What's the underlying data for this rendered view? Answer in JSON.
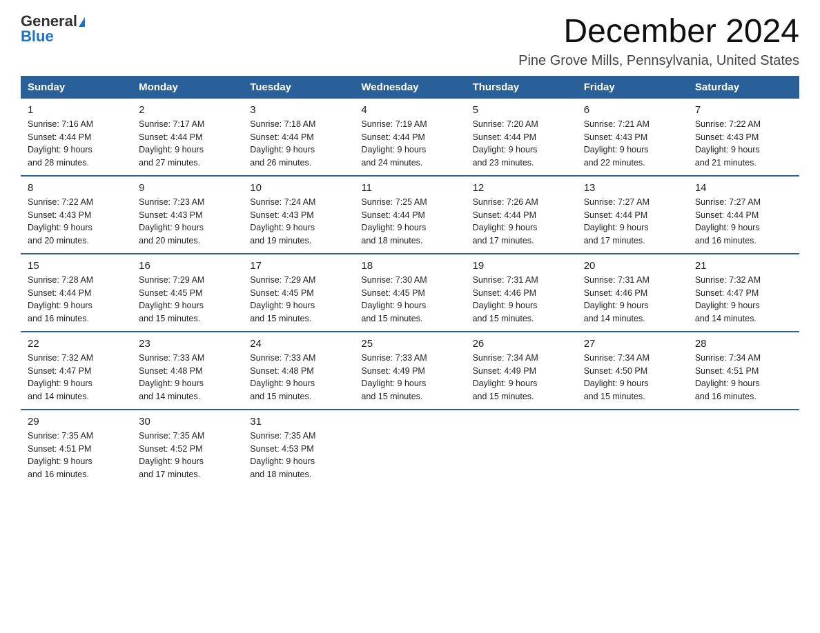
{
  "logo": {
    "general": "General",
    "blue": "Blue"
  },
  "header": {
    "title": "December 2024",
    "subtitle": "Pine Grove Mills, Pennsylvania, United States"
  },
  "days_of_week": [
    "Sunday",
    "Monday",
    "Tuesday",
    "Wednesday",
    "Thursday",
    "Friday",
    "Saturday"
  ],
  "weeks": [
    [
      {
        "day": "1",
        "sunrise": "7:16 AM",
        "sunset": "4:44 PM",
        "daylight": "9 hours and 28 minutes."
      },
      {
        "day": "2",
        "sunrise": "7:17 AM",
        "sunset": "4:44 PM",
        "daylight": "9 hours and 27 minutes."
      },
      {
        "day": "3",
        "sunrise": "7:18 AM",
        "sunset": "4:44 PM",
        "daylight": "9 hours and 26 minutes."
      },
      {
        "day": "4",
        "sunrise": "7:19 AM",
        "sunset": "4:44 PM",
        "daylight": "9 hours and 24 minutes."
      },
      {
        "day": "5",
        "sunrise": "7:20 AM",
        "sunset": "4:44 PM",
        "daylight": "9 hours and 23 minutes."
      },
      {
        "day": "6",
        "sunrise": "7:21 AM",
        "sunset": "4:43 PM",
        "daylight": "9 hours and 22 minutes."
      },
      {
        "day": "7",
        "sunrise": "7:22 AM",
        "sunset": "4:43 PM",
        "daylight": "9 hours and 21 minutes."
      }
    ],
    [
      {
        "day": "8",
        "sunrise": "7:22 AM",
        "sunset": "4:43 PM",
        "daylight": "9 hours and 20 minutes."
      },
      {
        "day": "9",
        "sunrise": "7:23 AM",
        "sunset": "4:43 PM",
        "daylight": "9 hours and 20 minutes."
      },
      {
        "day": "10",
        "sunrise": "7:24 AM",
        "sunset": "4:43 PM",
        "daylight": "9 hours and 19 minutes."
      },
      {
        "day": "11",
        "sunrise": "7:25 AM",
        "sunset": "4:44 PM",
        "daylight": "9 hours and 18 minutes."
      },
      {
        "day": "12",
        "sunrise": "7:26 AM",
        "sunset": "4:44 PM",
        "daylight": "9 hours and 17 minutes."
      },
      {
        "day": "13",
        "sunrise": "7:27 AM",
        "sunset": "4:44 PM",
        "daylight": "9 hours and 17 minutes."
      },
      {
        "day": "14",
        "sunrise": "7:27 AM",
        "sunset": "4:44 PM",
        "daylight": "9 hours and 16 minutes."
      }
    ],
    [
      {
        "day": "15",
        "sunrise": "7:28 AM",
        "sunset": "4:44 PM",
        "daylight": "9 hours and 16 minutes."
      },
      {
        "day": "16",
        "sunrise": "7:29 AM",
        "sunset": "4:45 PM",
        "daylight": "9 hours and 15 minutes."
      },
      {
        "day": "17",
        "sunrise": "7:29 AM",
        "sunset": "4:45 PM",
        "daylight": "9 hours and 15 minutes."
      },
      {
        "day": "18",
        "sunrise": "7:30 AM",
        "sunset": "4:45 PM",
        "daylight": "9 hours and 15 minutes."
      },
      {
        "day": "19",
        "sunrise": "7:31 AM",
        "sunset": "4:46 PM",
        "daylight": "9 hours and 15 minutes."
      },
      {
        "day": "20",
        "sunrise": "7:31 AM",
        "sunset": "4:46 PM",
        "daylight": "9 hours and 14 minutes."
      },
      {
        "day": "21",
        "sunrise": "7:32 AM",
        "sunset": "4:47 PM",
        "daylight": "9 hours and 14 minutes."
      }
    ],
    [
      {
        "day": "22",
        "sunrise": "7:32 AM",
        "sunset": "4:47 PM",
        "daylight": "9 hours and 14 minutes."
      },
      {
        "day": "23",
        "sunrise": "7:33 AM",
        "sunset": "4:48 PM",
        "daylight": "9 hours and 14 minutes."
      },
      {
        "day": "24",
        "sunrise": "7:33 AM",
        "sunset": "4:48 PM",
        "daylight": "9 hours and 15 minutes."
      },
      {
        "day": "25",
        "sunrise": "7:33 AM",
        "sunset": "4:49 PM",
        "daylight": "9 hours and 15 minutes."
      },
      {
        "day": "26",
        "sunrise": "7:34 AM",
        "sunset": "4:49 PM",
        "daylight": "9 hours and 15 minutes."
      },
      {
        "day": "27",
        "sunrise": "7:34 AM",
        "sunset": "4:50 PM",
        "daylight": "9 hours and 15 minutes."
      },
      {
        "day": "28",
        "sunrise": "7:34 AM",
        "sunset": "4:51 PM",
        "daylight": "9 hours and 16 minutes."
      }
    ],
    [
      {
        "day": "29",
        "sunrise": "7:35 AM",
        "sunset": "4:51 PM",
        "daylight": "9 hours and 16 minutes."
      },
      {
        "day": "30",
        "sunrise": "7:35 AM",
        "sunset": "4:52 PM",
        "daylight": "9 hours and 17 minutes."
      },
      {
        "day": "31",
        "sunrise": "7:35 AM",
        "sunset": "4:53 PM",
        "daylight": "9 hours and 18 minutes."
      },
      null,
      null,
      null,
      null
    ]
  ],
  "labels": {
    "sunrise": "Sunrise: ",
    "sunset": "Sunset: ",
    "daylight": "Daylight: "
  }
}
